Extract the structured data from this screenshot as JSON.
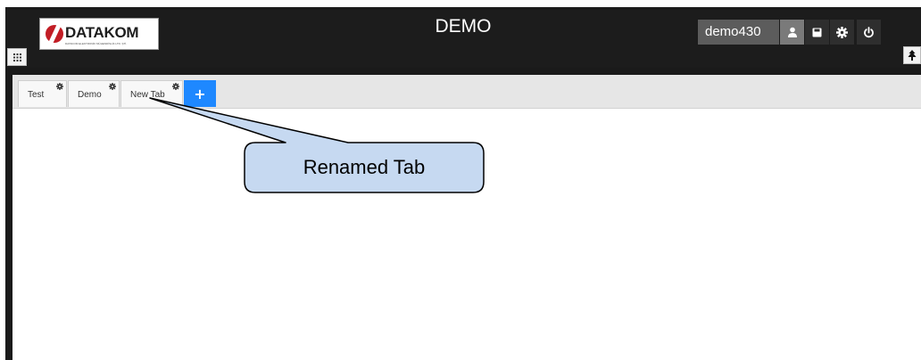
{
  "header": {
    "app_title": "DEMO",
    "brand_name": "DATAKOM",
    "brand_tagline": "DATAKOM ELEKTRONİK MÜHENDİSLİK LTD. ŞTİ.",
    "username": "demo430",
    "brand_color": "#c21d25"
  },
  "toolbar": {
    "icons": [
      "user-icon",
      "save-icon",
      "gear-icon",
      "power-icon"
    ]
  },
  "tabs": [
    {
      "label": "Test"
    },
    {
      "label": "Demo"
    },
    {
      "label": "New Tab"
    }
  ],
  "add_tab_label": "+",
  "annotation": {
    "text": "Renamed Tab"
  },
  "colors": {
    "accent": "#1e88ff",
    "callout_fill": "#c6d9f1",
    "header_bg": "#1c1c1c"
  }
}
